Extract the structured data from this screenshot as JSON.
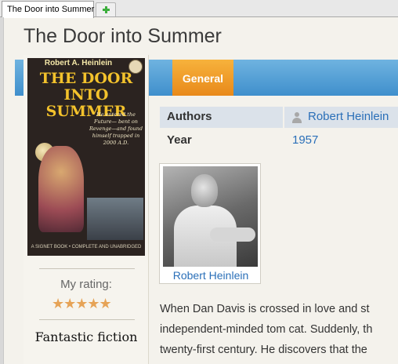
{
  "tabs": {
    "active_label": "The Door into Summer",
    "new_tab_icon": "plus-icon"
  },
  "page": {
    "title": "The Door into Summer"
  },
  "cover": {
    "author_text": "Robert A. Heinlein",
    "title_text": "THE DOOR INTO SUMMER",
    "blurb_text": "He entered the Future— bent on Revenge—and found himself trapped in 2000 A.D.",
    "footer_text": "A SIGNET BOOK • COMPLETE AND UNABRIDGED"
  },
  "rating": {
    "label": "My rating:",
    "stars": 5,
    "max": 5,
    "star_glyphs": "★★★★★",
    "star_color": "#e6a357"
  },
  "genre": "Fantastic fiction",
  "detail_tabs": {
    "general_label": "General"
  },
  "details": {
    "authors_label": "Authors",
    "authors_value": "Robert Heinlein",
    "year_label": "Year",
    "year_value": "1957"
  },
  "author_card": {
    "caption": "Robert Heinlein"
  },
  "description": {
    "line1": "When Dan Davis is crossed in love and st",
    "line2": "independent-minded tom cat. Suddenly, th",
    "line3": "twenty-first century. He discovers that the"
  },
  "colors": {
    "band": "#4a9ad4",
    "general_tab": "#f0a02a",
    "link": "#2a6fb8"
  }
}
